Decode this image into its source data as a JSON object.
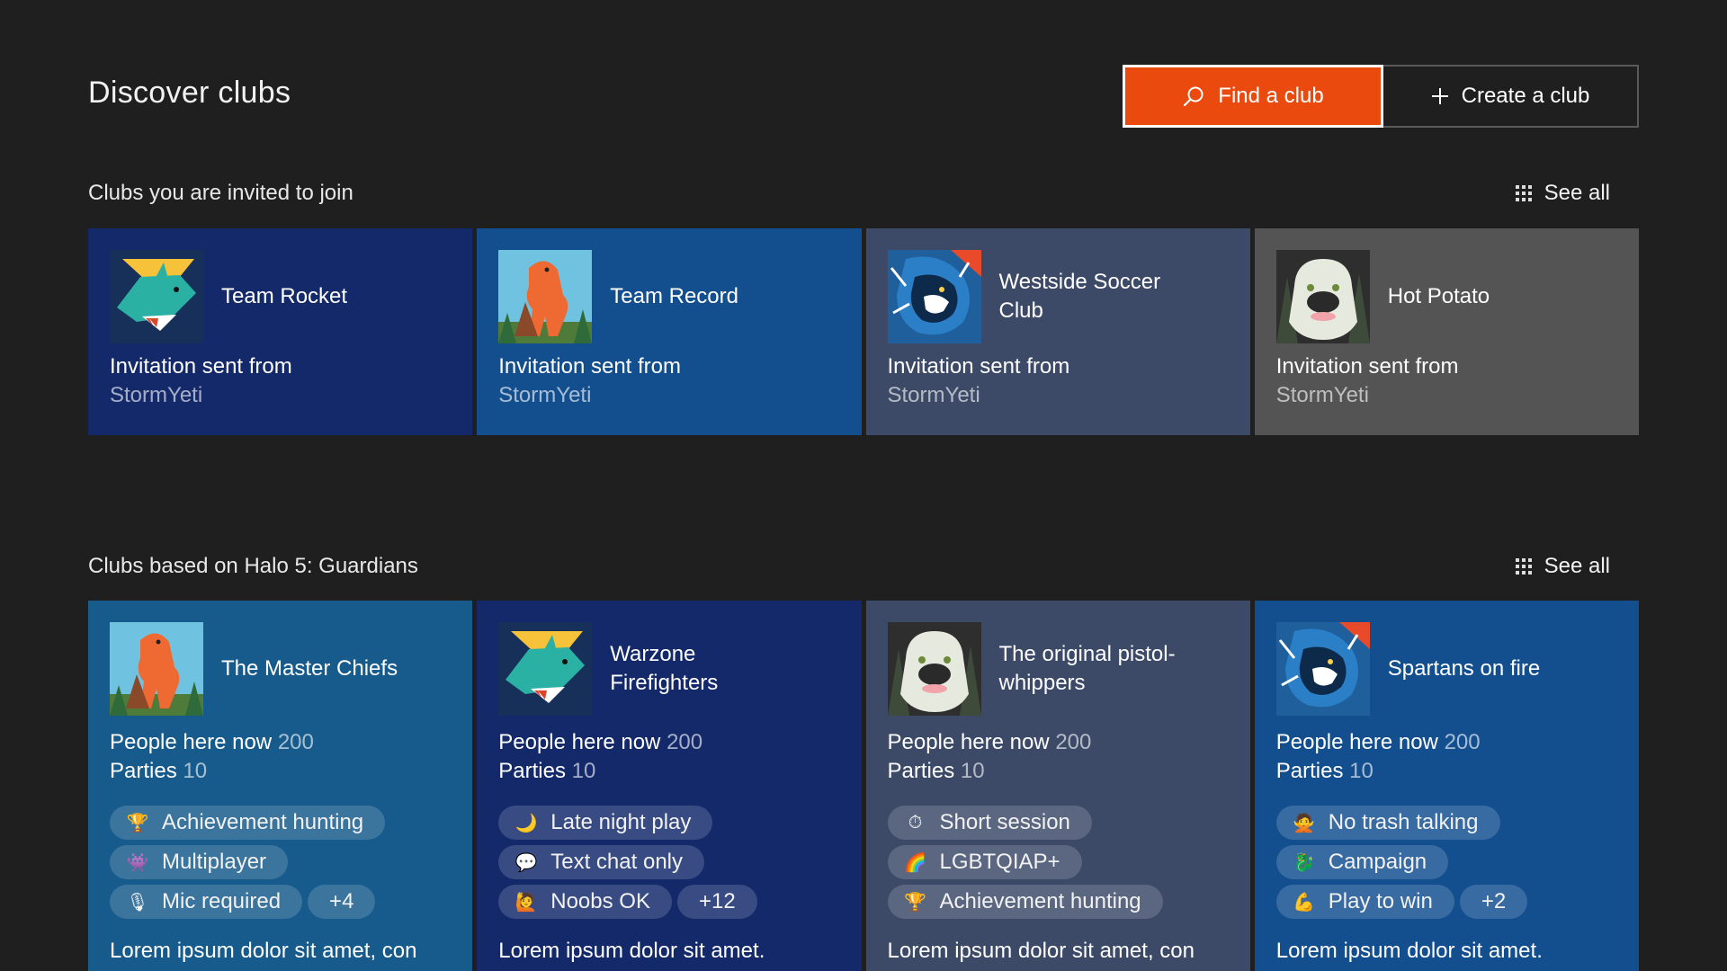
{
  "header": {
    "title": "Discover clubs",
    "find_label": "Find a club",
    "create_label": "Create a club"
  },
  "colors": {
    "background": "#1f1f1f",
    "accent": "#ea4a0d",
    "card_navy": "#13296a",
    "card_blue": "#134f8f",
    "card_slate": "#3c4a68",
    "card_gray": "#545454",
    "card_teal": "#165b8c"
  },
  "invited": {
    "title": "Clubs you are invited to join",
    "see_all": "See all",
    "cards": [
      {
        "name": "Team Rocket",
        "avatar": "shark-avatar",
        "invite_label": "Invitation sent from",
        "sender": "StormYeti",
        "color": "#13296a"
      },
      {
        "name": "Team Record",
        "avatar": "bigfoot-avatar",
        "invite_label": "Invitation sent from",
        "sender": "StormYeti",
        "color": "#134f8f"
      },
      {
        "name": "Westside Soccer Club",
        "avatar": "lion-avatar",
        "invite_label": "Invitation sent from",
        "sender": "StormYeti",
        "color": "#3c4a68"
      },
      {
        "name": "Hot Potato",
        "avatar": "yeti-avatar",
        "invite_label": "Invitation sent from",
        "sender": "StormYeti",
        "color": "#545454"
      }
    ]
  },
  "based_on": {
    "title": "Clubs based on Halo 5: Guardians",
    "see_all": "See all",
    "cards": [
      {
        "name": "The Master Chiefs",
        "avatar": "bigfoot-avatar",
        "color": "#165b8c",
        "people_label": "People here now",
        "people": "200",
        "parties_label": "Parties",
        "parties": "10",
        "tags": [
          {
            "icon": "trophy-icon",
            "emoji": "🏆",
            "label": "Achievement hunting"
          },
          {
            "icon": "invader-icon",
            "emoji": "👾",
            "label": "Multiplayer"
          },
          {
            "icon": "mic-icon",
            "emoji": "🎙",
            "label": "Mic required"
          }
        ],
        "more": "+4",
        "description": "Lorem ipsum dolor sit amet, con"
      },
      {
        "name": "Warzone Firefighters",
        "avatar": "shark-avatar",
        "color": "#13296a",
        "people_label": "People here now",
        "people": "200",
        "parties_label": "Parties",
        "parties": "10",
        "tags": [
          {
            "icon": "moon-icon",
            "emoji": "🌙",
            "label": "Late night play"
          },
          {
            "icon": "chat-icon",
            "emoji": "💬",
            "label": "Text chat only"
          },
          {
            "icon": "learner-icon",
            "emoji": "🙋",
            "label": "Noobs OK"
          }
        ],
        "more": "+12",
        "description": "Lorem ipsum dolor sit amet."
      },
      {
        "name": "The original pistol-whippers",
        "avatar": "yeti-avatar",
        "color": "#3c4a68",
        "people_label": "People here now",
        "people": "200",
        "parties_label": "Parties",
        "parties": "10",
        "tags": [
          {
            "icon": "stopwatch-icon",
            "emoji": "⏱",
            "label": "Short session"
          },
          {
            "icon": "rainbow-icon",
            "emoji": "🌈",
            "label": "LGBTQIAP+"
          },
          {
            "icon": "trophy-icon",
            "emoji": "🏆",
            "label": "Achievement hunting"
          }
        ],
        "more": "",
        "description": "Lorem ipsum dolor sit amet, con"
      },
      {
        "name": "Spartans on fire",
        "avatar": "lion-avatar",
        "color": "#134f8f",
        "people_label": "People here now",
        "people": "200",
        "parties_label": "Parties",
        "parties": "10",
        "tags": [
          {
            "icon": "no-gesture-icon",
            "emoji": "🙅",
            "label": "No trash talking"
          },
          {
            "icon": "dragon-icon",
            "emoji": "🐉",
            "label": "Campaign"
          },
          {
            "icon": "flex-icon",
            "emoji": "💪",
            "label": "Play to win"
          }
        ],
        "more": "+2",
        "description": "Lorem ipsum dolor sit amet."
      }
    ]
  }
}
